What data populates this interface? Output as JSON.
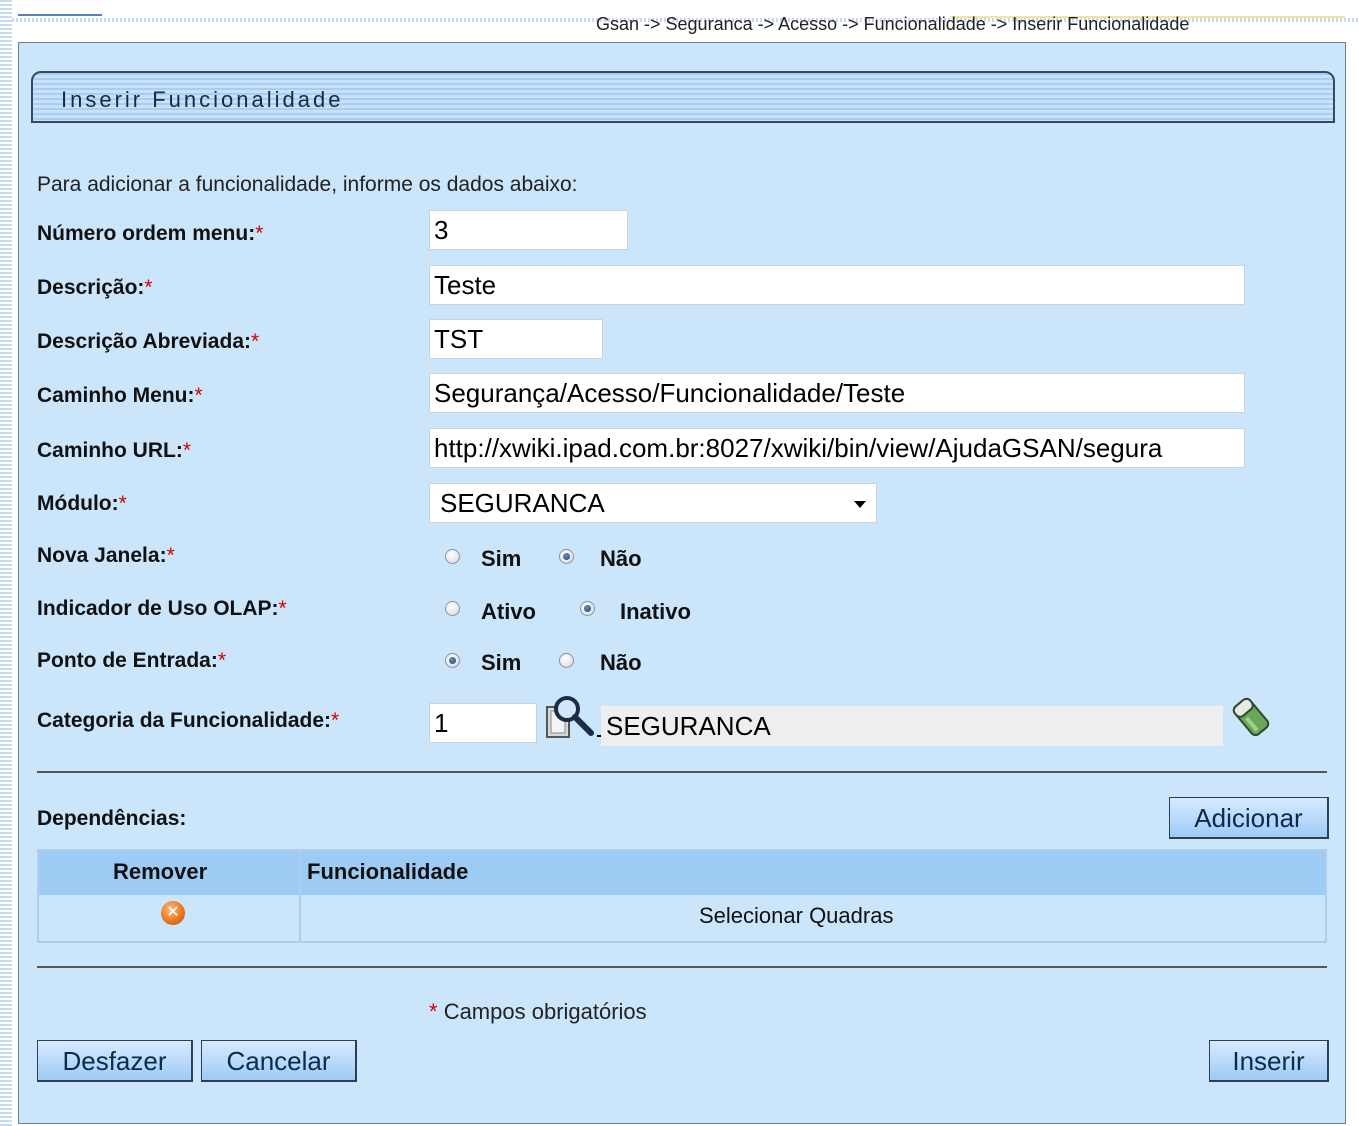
{
  "breadcrumb": "Gsan -> Seguranca -> Acesso -> Funcionalidade -> Inserir Funcionalidade",
  "title": "Inserir Funcionalidade",
  "intro": "Para adicionar a funcionalidade, informe os dados abaixo:",
  "required_mark": "*",
  "fields": {
    "numero_ordem": {
      "label": "Número ordem menu:",
      "value": "3"
    },
    "descricao": {
      "label": "Descrição:",
      "value": "Teste"
    },
    "descricao_abreviada": {
      "label": "Descrição Abreviada:",
      "value": "TST"
    },
    "caminho_menu": {
      "label": "Caminho Menu:",
      "value": "Segurança/Acesso/Funcionalidade/Teste"
    },
    "caminho_url": {
      "label": "Caminho URL:",
      "value": "http://xwiki.ipad.com.br:8027/xwiki/bin/view/AjudaGSAN/segura"
    },
    "modulo": {
      "label": "Módulo:",
      "selected": "SEGURANCA"
    },
    "nova_janela": {
      "label": "Nova Janela:",
      "option_1": "Sim",
      "option_2": "Não",
      "selected": "Não"
    },
    "olap": {
      "label": "Indicador de Uso OLAP:",
      "option_1": "Ativo",
      "option_2": "Inativo",
      "selected": "Inativo"
    },
    "ponto_entrada": {
      "label": "Ponto de Entrada:",
      "option_1": "Sim",
      "option_2": "Não",
      "selected": "Sim"
    },
    "categoria": {
      "label": "Categoria da Funcionalidade:",
      "code": "1",
      "description": "SEGURANCA"
    }
  },
  "icons": {
    "search": "search-icon",
    "eraser": "eraser-icon",
    "remove": "remove-icon"
  },
  "dependencias": {
    "label": "Dependências:",
    "add_button": "Adicionar",
    "columns": [
      "Remover",
      "Funcionalidade"
    ],
    "rows": [
      {
        "funcionalidade": "Selecionar Quadras"
      }
    ]
  },
  "footer": {
    "required_note": "Campos obrigatórios",
    "buttons": {
      "desfazer": "Desfazer",
      "cancelar": "Cancelar",
      "inserir": "Inserir"
    }
  },
  "colors": {
    "panel_bg": "#cbe5fb",
    "header_bg": "#9ecbf3",
    "required": "#d40000"
  }
}
